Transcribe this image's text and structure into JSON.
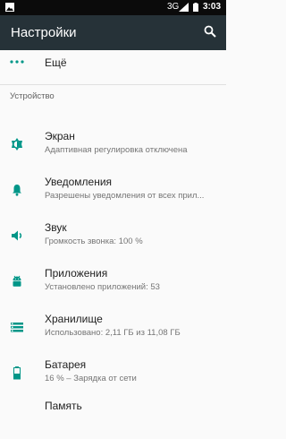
{
  "status_bar": {
    "network": "3G",
    "time": "3:03"
  },
  "app_bar": {
    "title": "Настройки"
  },
  "more": {
    "label": "Ещё"
  },
  "section": {
    "header": "Устройство"
  },
  "items": [
    {
      "title": "Экран",
      "subtitle": "Адаптивная регулировка отключена",
      "icon": "brightness-icon"
    },
    {
      "title": "Уведомления",
      "subtitle": "Разрешены уведомления от всех прил...",
      "icon": "bell-icon"
    },
    {
      "title": "Звук",
      "subtitle": "Громкость звонка: 100 %",
      "icon": "volume-icon"
    },
    {
      "title": "Приложения",
      "subtitle": "Установлено приложений: 53",
      "icon": "android-icon"
    },
    {
      "title": "Хранилище",
      "subtitle": "Использовано: 2,11 ГБ из 11,08 ГБ",
      "icon": "storage-icon"
    },
    {
      "title": "Батарея",
      "subtitle": "16 % – Зарядка от сети",
      "icon": "battery-icon"
    },
    {
      "title": "Память",
      "subtitle": "",
      "icon": "memory-icon"
    }
  ],
  "colors": {
    "accent": "#009688",
    "app_bar": "#263238",
    "status_bar": "#0b0b0b"
  }
}
